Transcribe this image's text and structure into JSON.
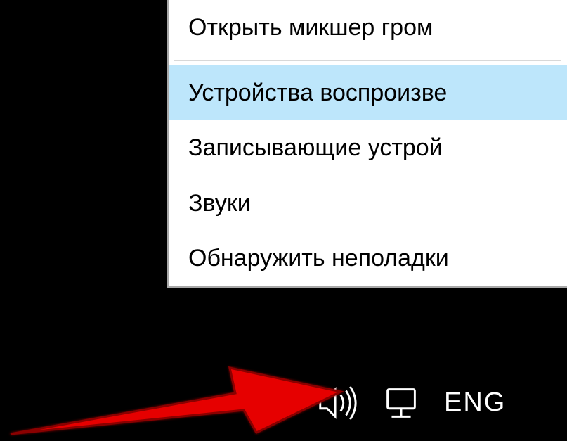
{
  "context_menu": {
    "items": [
      {
        "label": "Открыть микшер гром",
        "highlighted": false
      },
      {
        "separator": true
      },
      {
        "label": "Устройства воспроизве",
        "highlighted": true
      },
      {
        "label": "Записывающие устрой",
        "highlighted": false
      },
      {
        "label": "Звуки",
        "highlighted": false
      },
      {
        "label": "Обнаружить неполадки",
        "highlighted": false
      }
    ]
  },
  "taskbar": {
    "language": "ENG"
  }
}
